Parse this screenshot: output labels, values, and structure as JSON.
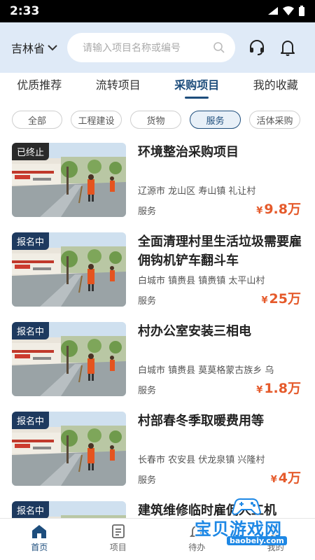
{
  "status_bar": {
    "time": "2:33"
  },
  "header": {
    "province": "吉林省",
    "search_placeholder": "请输入项目名称或编号"
  },
  "tabs": [
    {
      "label": "优质推荐",
      "active": false
    },
    {
      "label": "流转项目",
      "active": false
    },
    {
      "label": "采购项目",
      "active": true
    },
    {
      "label": "我的收藏",
      "active": false
    }
  ],
  "filters": [
    {
      "label": "全部",
      "active": false
    },
    {
      "label": "工程建设",
      "active": false
    },
    {
      "label": "货物",
      "active": false
    },
    {
      "label": "服务",
      "active": true
    },
    {
      "label": "活体采购",
      "active": false
    }
  ],
  "items": [
    {
      "badge": "已终止",
      "title": "环境整治采购项目",
      "location": "辽源市 龙山区 寿山镇 礼让村",
      "category": "服务",
      "price_symbol": "¥",
      "price": "9.8万"
    },
    {
      "badge": "报名中",
      "title": "全面清理村里生活垃圾需要雇佣钩机铲车翻斗车",
      "location": "白城市 镇赉县 镇赉镇 太平山村",
      "category": "服务",
      "price_symbol": "¥",
      "price": "25万"
    },
    {
      "badge": "报名中",
      "title": "村办公室安装三相电",
      "location": "白城市 镇赉县 莫莫格蒙古族乡 乌",
      "category": "服务",
      "price_symbol": "¥",
      "price": "1.8万"
    },
    {
      "badge": "报名中",
      "title": "村部春冬季取暖费用等",
      "location": "长春市 农安县 伏龙泉镇 兴隆村",
      "category": "服务",
      "price_symbol": "¥",
      "price": "4万"
    },
    {
      "badge": "报名中",
      "title": "建筑维修临时雇佣人工机",
      "location": "",
      "category": "",
      "price_symbol": "",
      "price": ""
    }
  ],
  "bottom_nav": [
    {
      "label": "首页",
      "icon": "home-icon",
      "active": true
    },
    {
      "label": "项目",
      "icon": "project-icon",
      "active": false
    },
    {
      "label": "待办",
      "icon": "todo-icon",
      "active": false
    },
    {
      "label": "我的",
      "icon": "profile-icon",
      "active": false
    }
  ],
  "watermark": {
    "text": "宝贝游戏网",
    "url": "baobeiy.com"
  },
  "colors": {
    "accent": "#1d4d7c",
    "price": "#e55a2b",
    "header_bg": "#dfeaf7"
  }
}
